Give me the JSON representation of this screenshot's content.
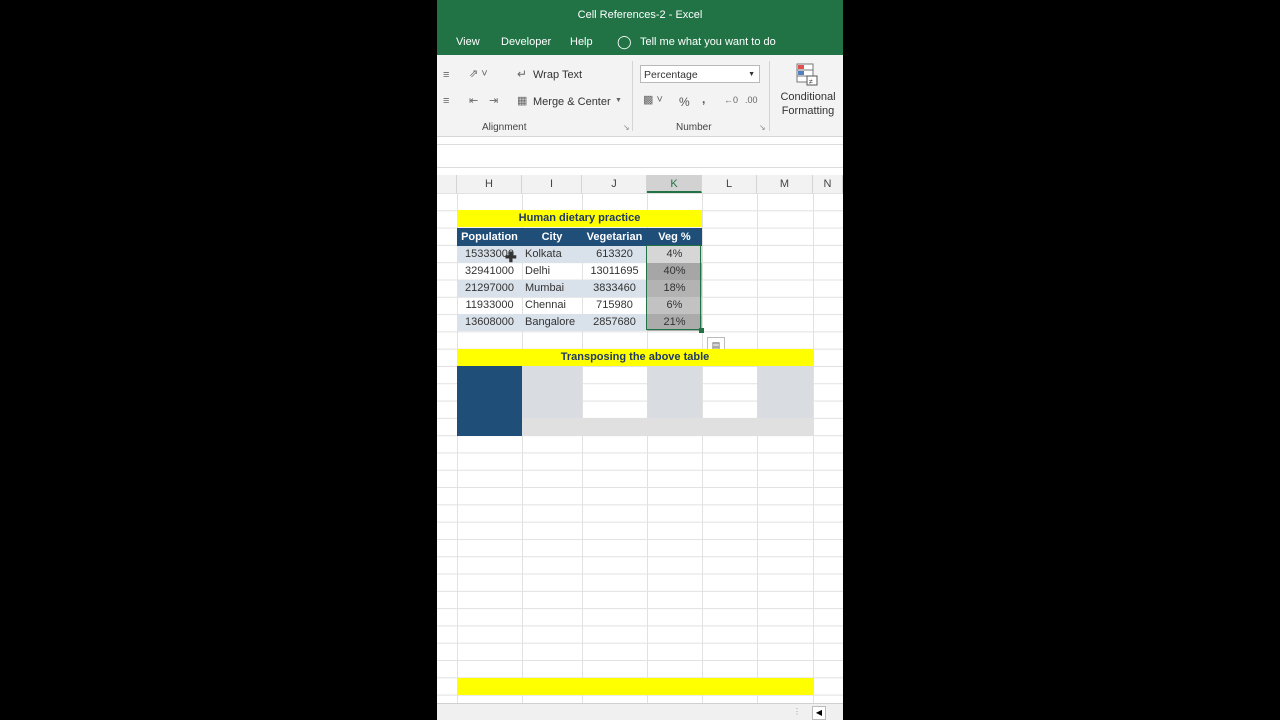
{
  "window": {
    "title": "Cell References-2  -  Excel"
  },
  "menu": {
    "items": [
      "View",
      "Developer",
      "Help"
    ],
    "tell_me": "Tell me what you want to do"
  },
  "ribbon": {
    "wrap_text": "Wrap Text",
    "merge_center": "Merge & Center",
    "alignment_group": "Alignment",
    "number_format": "Percentage",
    "percent_symbol": "%",
    "comma_symbol": ",",
    "number_group": "Number",
    "conditional_formatting_line1": "Conditional",
    "conditional_formatting_line2": "Formatting"
  },
  "columns": [
    {
      "label": "H",
      "selected": false
    },
    {
      "label": "I",
      "selected": false
    },
    {
      "label": "J",
      "selected": false
    },
    {
      "label": "K",
      "selected": true
    },
    {
      "label": "L",
      "selected": false
    },
    {
      "label": "M",
      "selected": false
    },
    {
      "label": "N",
      "selected": false
    }
  ],
  "sheet": {
    "title": "Human dietary practice",
    "headers": [
      "Population",
      "City",
      "Vegetarian",
      "Veg %"
    ],
    "rows": [
      {
        "population": "15333000",
        "city": "Kolkata",
        "vegetarian": "613320",
        "veg_pct": "4%"
      },
      {
        "population": "32941000",
        "city": "Delhi",
        "vegetarian": "13011695",
        "veg_pct": "40%"
      },
      {
        "population": "21297000",
        "city": "Mumbai",
        "vegetarian": "3833460",
        "veg_pct": "18%"
      },
      {
        "population": "11933000",
        "city": "Chennai",
        "vegetarian": "715980",
        "veg_pct": "6%"
      },
      {
        "population": "13608000",
        "city": "Bangalore",
        "vegetarian": "2857680",
        "veg_pct": "21%"
      }
    ],
    "transpose_title": "Transposing the above table"
  },
  "colors": {
    "excel_green": "#217346",
    "header_blue": "#1f4e79",
    "highlight_yellow": "#ffff00",
    "band": "#d9e1ea"
  }
}
